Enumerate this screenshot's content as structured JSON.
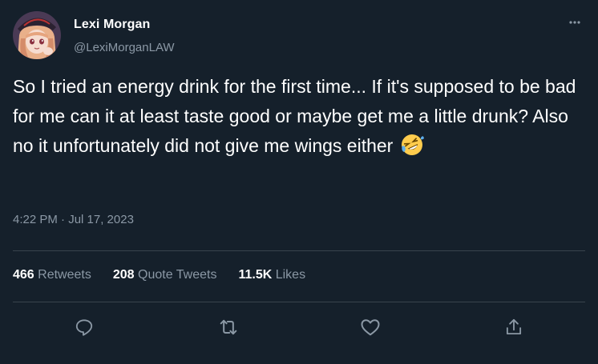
{
  "author": {
    "display_name": "Lexi Morgan",
    "handle": "@LexiMorganLAW"
  },
  "tweet": {
    "text": "So I tried an energy drink for the first time... If it's supposed to be bad for me can it at least taste good or maybe get me a little drunk? Also no it unfortunately did not give me wings either",
    "emoji": "rolling-on-the-floor-laughing",
    "timestamp": "4:22 PM · Jul 17, 2023"
  },
  "stats": {
    "retweets_count": "466",
    "retweets_label": "Retweets",
    "quote_count": "208",
    "quote_label": "Quote Tweets",
    "likes_count": "11.5K",
    "likes_label": "Likes"
  },
  "icons": {
    "more": "more-horizontal-icon",
    "reply": "reply-icon",
    "retweet": "retweet-icon",
    "like": "heart-icon",
    "share": "share-icon"
  },
  "colors": {
    "background": "#15202b",
    "text": "#ffffff",
    "secondary_text": "#8b98a5",
    "divider": "#38444d"
  }
}
